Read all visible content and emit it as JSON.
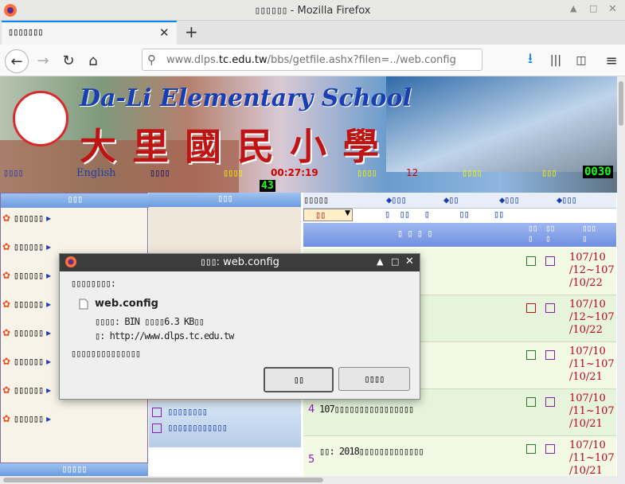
{
  "window": {
    "title": "Mozilla Firefox",
    "title_cjk": "▯▯▯▯▯▯"
  },
  "tab": {
    "label": "▯▯▯▯▯▯▯"
  },
  "nav": {
    "url_host": "www.dlps.",
    "url_domain": "tc.edu.tw",
    "url_path": "/bbs/getfile.ashx?filen=../web.config"
  },
  "banner": {
    "school_en": "Da-Li Elementary School",
    "school_zh": "大 里 國 民 小 學",
    "english_link": "English",
    "clock": "00:27:19",
    "counter1": "12",
    "counter2": "0030",
    "counter3": "43"
  },
  "left_panel": {
    "header": "▯▯▯",
    "footer": "▯▯▯▯▯",
    "items": [
      "▯▯▯▯▯▯",
      "▯▯▯▯▯▯",
      "▯▯▯▯▯▯",
      "▯▯▯▯▯▯",
      "▯▯▯▯▯▯",
      "▯▯▯▯▯▯",
      "▯▯▯▯▯▯",
      "▯▯▯▯▯▯"
    ]
  },
  "mid_panel": {
    "header": "▯▯▯",
    "link1": "▯▯▯▯▯▯▯▯",
    "link2": "▯▯▯▯▯▯▯▯▯▯▯▯"
  },
  "news": {
    "select_value": "▯▯",
    "rows": [
      {
        "num": "",
        "title": "▯▯▯▯▯▯▯▯▯▯▯▯▯▯▯▯▯▯",
        "date": "107/10\n/12~107\n/10/22"
      },
      {
        "num": "",
        "title": "▯▯▯▯▯▯▯▯▯▯▯▯▯▯",
        "date": "107/10\n/12~107\n/10/22"
      },
      {
        "num": "",
        "title": "▯▯▯▯▯▯▯",
        "date": "107/10\n/11~107\n/10/21"
      },
      {
        "num": "4",
        "title": "107▯▯▯▯▯▯▯▯▯▯▯▯▯▯▯▯",
        "date": "107/10\n/11~107\n/10/21"
      },
      {
        "num": "5",
        "title": "▯▯: 2018▯▯▯▯▯▯▯▯▯▯▯▯▯",
        "date": "107/10\n/11~107\n/10/21"
      }
    ]
  },
  "dialog": {
    "title_prefix": "▯▯▯",
    "title_file": ": web.config",
    "prompt": "▯▯▯▯▯▯▯▯:",
    "filename": "web.config",
    "type_label": "▯▯▯▯: BIN ▯▯▯▯6.3 KB▯▯",
    "from_label": "▯: http://www.dlps.tc.edu.tw",
    "question": "▯▯▯▯▯▯▯▯▯▯▯▯▯▯",
    "btn_save": "▯▯",
    "btn_cancel": "▯▯▯▯"
  },
  "colors": {
    "accent": "#0a84ff",
    "dialog_title": "#3c3c3c",
    "news_red": "#c0001e",
    "news_purple": "#8b1cb0"
  }
}
